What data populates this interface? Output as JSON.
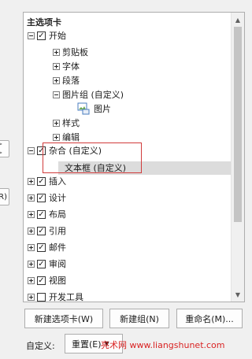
{
  "left_buttons": {
    "add_arrow": "> >",
    "reset": "R)"
  },
  "panel": {
    "header": "主选项卡",
    "rows": [
      {
        "id": "kaishi",
        "label": "开始",
        "expander": "minus",
        "checked": true
      },
      {
        "id": "jiantieban",
        "label": "剪贴板",
        "expander": "plus"
      },
      {
        "id": "ziti",
        "label": "字体",
        "expander": "plus"
      },
      {
        "id": "duanluo",
        "label": "段落",
        "expander": "plus"
      },
      {
        "id": "tupianzu",
        "label": "图片组 (自定义)",
        "expander": "minus"
      },
      {
        "id": "tupian",
        "label": "图片",
        "icon": "picture-icon"
      },
      {
        "id": "yangshi",
        "label": "样式",
        "expander": "plus"
      },
      {
        "id": "bianji",
        "label": "编辑",
        "expander": "plus"
      },
      {
        "id": "zaxiang",
        "label": "杂合 (自定义)",
        "expander": "minus",
        "checked": true
      },
      {
        "id": "wenbenkuang",
        "label": "文本框 (自定义)",
        "selected": true
      },
      {
        "id": "charu",
        "label": "插入",
        "expander": "plus",
        "checked": true
      },
      {
        "id": "sheji",
        "label": "设计",
        "expander": "plus",
        "checked": true
      },
      {
        "id": "buju",
        "label": "布局",
        "expander": "plus",
        "checked": true
      },
      {
        "id": "yinyong",
        "label": "引用",
        "expander": "plus",
        "checked": true
      },
      {
        "id": "youjian",
        "label": "邮件",
        "expander": "plus",
        "checked": true
      },
      {
        "id": "shenyue",
        "label": "审阅",
        "expander": "plus",
        "checked": true
      },
      {
        "id": "shitu",
        "label": "视图",
        "expander": "plus",
        "checked": true
      },
      {
        "id": "kaifagongju",
        "label": "开发工具",
        "expander": "plus",
        "checked": false
      }
    ]
  },
  "buttons": {
    "new_tab": "新建选项卡(W)",
    "new_group": "新建组(N)",
    "rename": "重命名(M)..."
  },
  "bottom": {
    "customize_label": "自定义:",
    "reset_button": "重置(E)"
  },
  "watermark": "亮术网 www.liangshunet.com",
  "colors": {
    "highlight_border": "#d13b3b",
    "watermark": "#d92323",
    "selected_row": "#dcdcdc"
  }
}
